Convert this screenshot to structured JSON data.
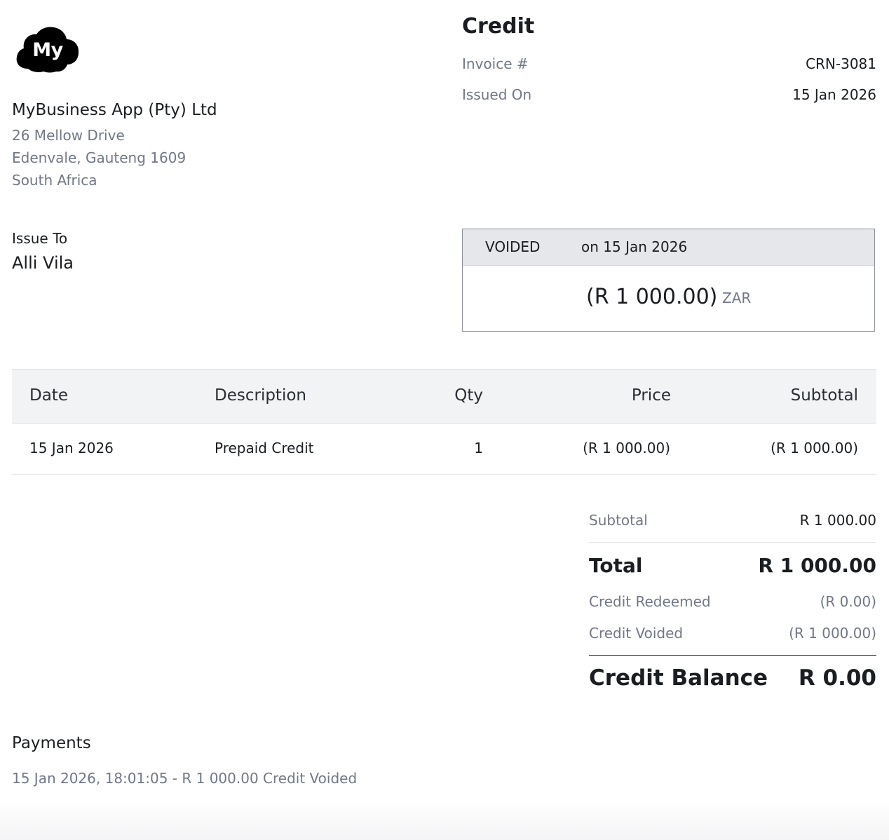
{
  "logo": {
    "text": "My"
  },
  "company": {
    "name": "MyBusiness App (Pty) Ltd",
    "address_line1": "26 Mellow Drive",
    "address_line2": "Edenvale, Gauteng 1609",
    "address_line3": "South Africa"
  },
  "document": {
    "title": "Credit",
    "invoice_label": "Invoice #",
    "invoice_number": "CRN-3081",
    "issued_label": "Issued On",
    "issued_date": "15 Jan 2026"
  },
  "issue_to": {
    "label": "Issue To",
    "name": "Alli Vila"
  },
  "status": {
    "word": "VOIDED",
    "date_text": "on 15 Jan 2026",
    "amount": "(R 1 000.00)",
    "currency": "ZAR"
  },
  "table": {
    "headers": [
      "Date",
      "Description",
      "Qty",
      "Price",
      "Subtotal"
    ],
    "rows": [
      {
        "date": "15 Jan 2026",
        "description": "Prepaid Credit",
        "qty": "1",
        "price": "(R 1 000.00)",
        "subtotal": "(R 1 000.00)"
      }
    ]
  },
  "summary": {
    "subtotal_label": "Subtotal",
    "subtotal_value": "R 1 000.00",
    "total_label": "Total",
    "total_value": "R 1 000.00",
    "redeemed_label": "Credit Redeemed",
    "redeemed_value": "(R 0.00)",
    "voided_label": "Credit Voided",
    "voided_value": "(R 1 000.00)",
    "balance_label": "Credit Balance",
    "balance_value": "R 0.00"
  },
  "payments": {
    "title": "Payments",
    "entries": [
      "15 Jan 2026, 18:01:05 - R 1 000.00 Credit Voided"
    ]
  },
  "colors": {
    "text": "#1a1d21",
    "muted": "#717785",
    "header_bg": "#f2f3f5",
    "status_bg": "#e6e7ea",
    "logo_bg": "#000000"
  }
}
